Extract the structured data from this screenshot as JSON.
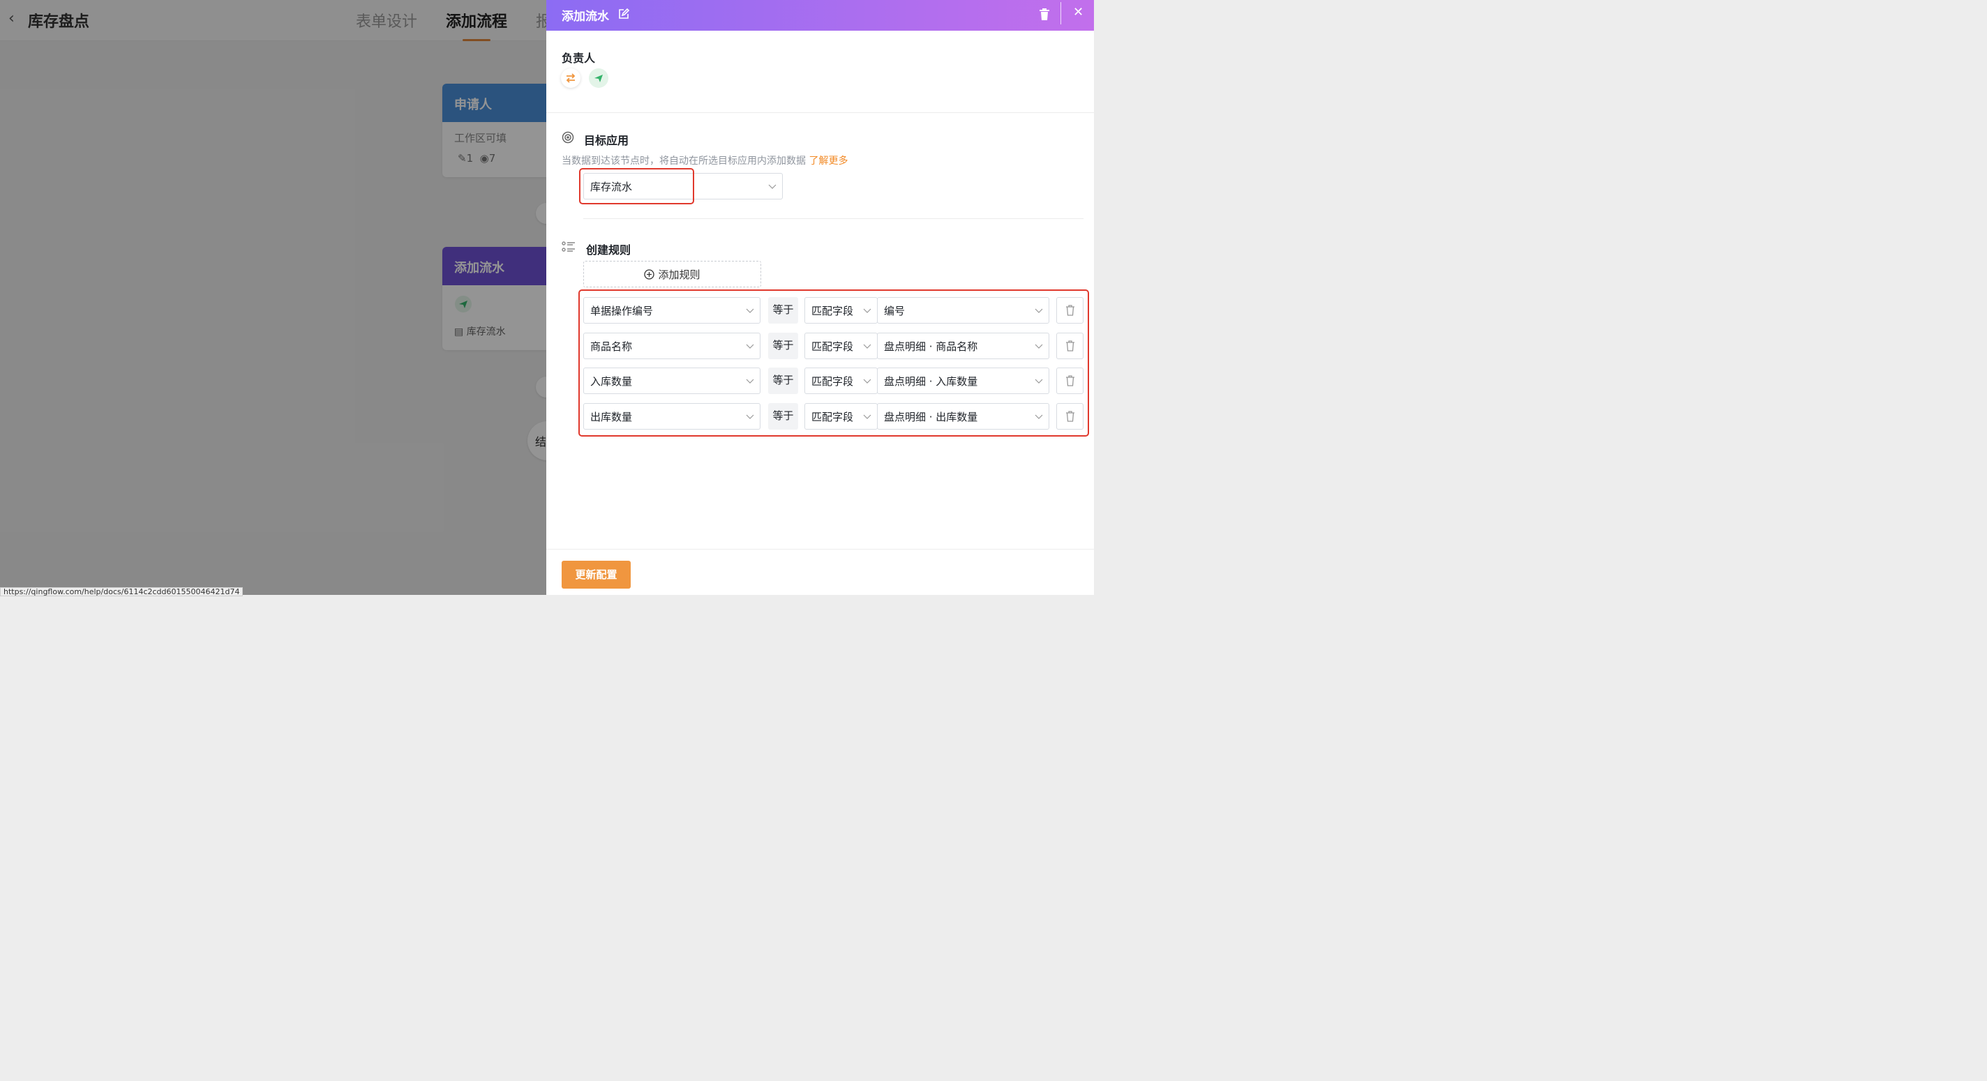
{
  "app": {
    "back_icon": "chevron-left-icon",
    "title": "库存盘点",
    "tabs": [
      "表单设计",
      "添加流程",
      "报"
    ],
    "active_tab_index": 1
  },
  "flow": {
    "applicant_node": {
      "title": "申请人",
      "subtitle": "工作区可填",
      "edit_count": "1",
      "view_count": "7",
      "color": "#4a90d9"
    },
    "add_node": {
      "title": "添加流水",
      "target": "库存流水",
      "color": "#6f52d6"
    },
    "end_node_label": "结"
  },
  "status_url": "https://qingflow.com/help/docs/6114c2cdd601550046421d74",
  "drawer": {
    "title": "添加流水",
    "owner_label": "负责人",
    "owner_icons": [
      "swap-icon",
      "send-icon"
    ],
    "target_app": {
      "label": "目标应用",
      "description": "当数据到达该节点时，将自动在所选目标应用内添加数据",
      "learn_more": "了解更多",
      "selected": "库存流水"
    },
    "create_rules": {
      "label": "创建规则",
      "add_rule": "添加规则",
      "rules": [
        {
          "field": "单据操作编号",
          "op": "等于",
          "mode": "匹配字段",
          "value": "编号"
        },
        {
          "field": "商品名称",
          "op": "等于",
          "mode": "匹配字段",
          "value": "盘点明细 · 商品名称"
        },
        {
          "field": "入库数量",
          "op": "等于",
          "mode": "匹配字段",
          "value": "盘点明细 · 入库数量"
        },
        {
          "field": "出库数量",
          "op": "等于",
          "mode": "匹配字段",
          "value": "盘点明细 · 出库数量"
        }
      ]
    },
    "update_button": "更新配置"
  },
  "colors": {
    "accent": "#f0963f",
    "header_gradient_start": "#8c6cf3",
    "header_gradient_end": "#c26fec",
    "highlight": "#e0392d"
  }
}
